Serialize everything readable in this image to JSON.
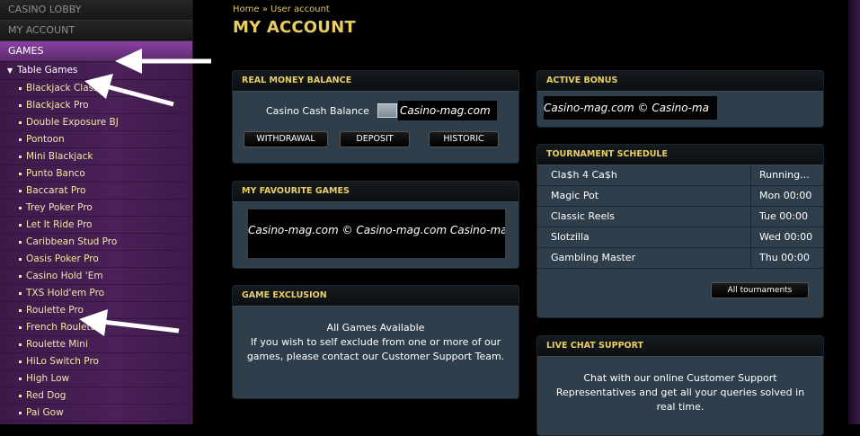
{
  "nav": {
    "casino_lobby": "CASINO LOBBY",
    "my_account": "MY ACCOUNT",
    "games": "GAMES",
    "category": "Table Games",
    "items": [
      {
        "label": "Blackjack Classic"
      },
      {
        "label": "Blackjack Pro"
      },
      {
        "label": "Double Exposure BJ"
      },
      {
        "label": "Pontoon"
      },
      {
        "label": "Mini Blackjack"
      },
      {
        "label": "Punto Banco"
      },
      {
        "label": "Baccarat Pro"
      },
      {
        "label": "Trey Poker Pro"
      },
      {
        "label": "Let It Ride Pro"
      },
      {
        "label": "Caribbean Stud Pro"
      },
      {
        "label": "Oasis Poker Pro"
      },
      {
        "label": "Casino Hold 'Em"
      },
      {
        "label": "TXS Hold'em Pro"
      },
      {
        "label": "Roulette Pro"
      },
      {
        "label": "French Roulette"
      },
      {
        "label": "Roulette Mini"
      },
      {
        "label": "HiLo Switch Pro"
      },
      {
        "label": "High Low"
      },
      {
        "label": "Red Dog"
      },
      {
        "label": "Pai Gow"
      }
    ]
  },
  "breadcrumb": {
    "home": "Home",
    "sep": "»",
    "current": "User account"
  },
  "page_title": "MY ACCOUNT",
  "balance": {
    "title": "REAL MONEY BALANCE",
    "label": "Casino Cash Balance",
    "watermark": "Casino-mag.com",
    "buttons": [
      "WITHDRAWAL",
      "DEPOSIT",
      "HISTORIC"
    ]
  },
  "favourites": {
    "title": "MY FAVOURITE GAMES",
    "watermark": "Casino-mag.com © Casino-mag.com Casino-ma"
  },
  "exclusion": {
    "title": "GAME EXCLUSION",
    "line1": "All Games Available",
    "line2": "If you wish to self exclude from one or more of our games, please contact our Customer Support Team."
  },
  "bonus": {
    "title": "ACTIVE BONUS",
    "watermark": "Casino-mag.com © Casino-ma"
  },
  "tournaments": {
    "title": "TOURNAMENT SCHEDULE",
    "rows": [
      {
        "name": "Cla$h 4 Ca$h",
        "time": "Running..."
      },
      {
        "name": "Magic Pot",
        "time": "Mon 00:00"
      },
      {
        "name": "Classic Reels",
        "time": "Tue 00:00"
      },
      {
        "name": "Slotzilla",
        "time": "Wed 00:00"
      },
      {
        "name": "Gambling Master",
        "time": "Thu 00:00"
      }
    ],
    "all_button": "All tournaments"
  },
  "chat": {
    "title": "LIVE CHAT SUPPORT",
    "text": "Chat with our online Customer Support Representatives and get all your queries solved in real time."
  },
  "colors": {
    "accent_gold": "#e9cf62",
    "panel_bg": "#2f3e4b",
    "sidebar_bg": "#4a2058"
  }
}
